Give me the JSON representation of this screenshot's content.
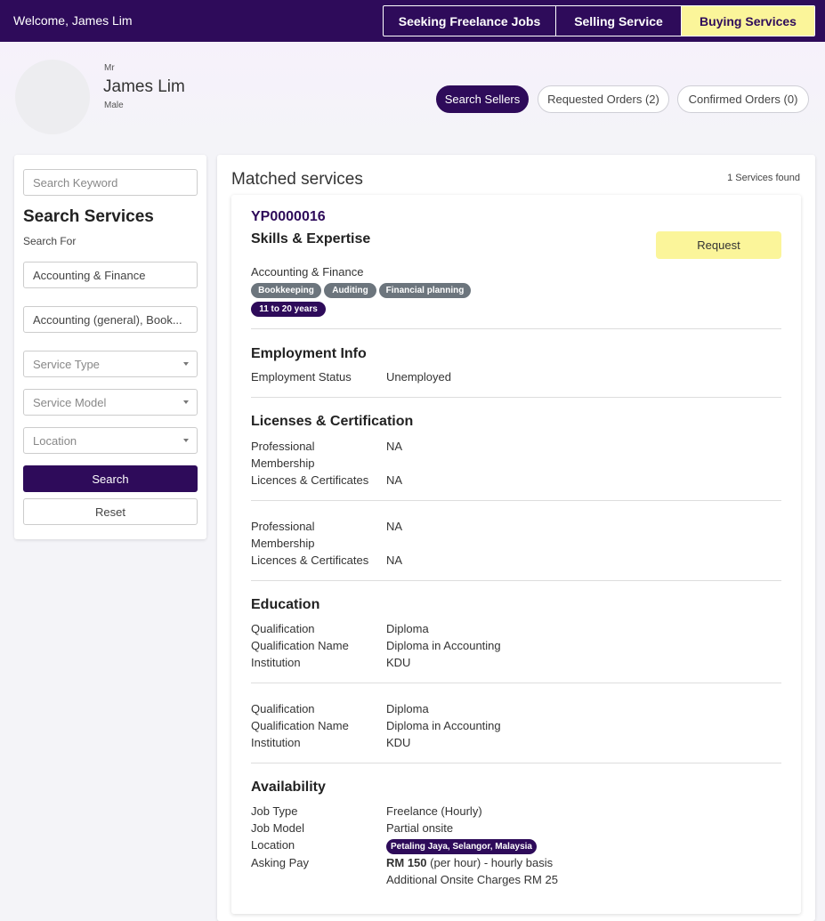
{
  "topbar": {
    "welcome": "Welcome, James Lim",
    "modes": [
      "Seeking Freelance Jobs",
      "Selling Service",
      "Buying Services"
    ],
    "active_mode": "Buying Services"
  },
  "profile": {
    "salutation": "Mr",
    "name": "James Lim",
    "gender": "Male"
  },
  "nav": {
    "search_sellers": "Search Sellers",
    "requested_orders": "Requested Orders (2)",
    "confirmed_orders": "Confirmed Orders (0)"
  },
  "sidebar": {
    "keyword_placeholder": "Search Keyword",
    "title": "Search Services",
    "subtitle": "Search For",
    "category": "Accounting & Finance",
    "subcategory": "Accounting (general), Book...",
    "service_type_placeholder": "Service Type",
    "service_model_placeholder": "Service Model",
    "location_placeholder": "Location",
    "search_label": "Search",
    "reset_label": "Reset"
  },
  "results": {
    "title": "Matched services",
    "count_text": "1 Services found"
  },
  "card": {
    "id": "YP0000016",
    "skills_heading": "Skills & Expertise",
    "request_label": "Request",
    "category": "Accounting & Finance",
    "skills": [
      "Bookkeeping",
      "Auditing",
      "Financial planning"
    ],
    "experience": "11 to 20 years",
    "employment": {
      "heading": "Employment Info",
      "status_label": "Employment Status",
      "status_value": "Unemployed"
    },
    "licenses": {
      "heading": "Licenses & Certification",
      "entries": [
        {
          "membership_label": "Professional Membership",
          "membership_value": "NA",
          "certs_label": "Licences & Certificates",
          "certs_value": "NA"
        },
        {
          "membership_label": "Professional Membership",
          "membership_value": "NA",
          "certs_label": "Licences & Certificates",
          "certs_value": "NA"
        }
      ]
    },
    "education": {
      "heading": "Education",
      "entries": [
        {
          "qualification_label": "Qualification",
          "qualification": "Diploma",
          "name_label": "Qualification Name",
          "name": "Diploma in Accounting",
          "institution_label": "Institution",
          "institution": "KDU"
        },
        {
          "qualification_label": "Qualification",
          "qualification": "Diploma",
          "name_label": "Qualification Name",
          "name": "Diploma in Accounting",
          "institution_label": "Institution",
          "institution": "KDU"
        }
      ]
    },
    "availability": {
      "heading": "Availability",
      "job_type_label": "Job Type",
      "job_type": "Freelance (Hourly)",
      "job_model_label": "Job Model",
      "job_model": "Partial onsite",
      "location_label": "Location",
      "location": "Petaling Jaya, Selangor, Malaysia",
      "pay_label": "Asking Pay",
      "pay_amount": "RM 150",
      "pay_rest": " (per hour) - hourly basis",
      "onsite_charges": "Additional Onsite Charges RM 25"
    }
  },
  "colors": {
    "brand": "#2e0b5a",
    "highlight": "#fbf59a",
    "tag_gray": "#6c757d"
  }
}
